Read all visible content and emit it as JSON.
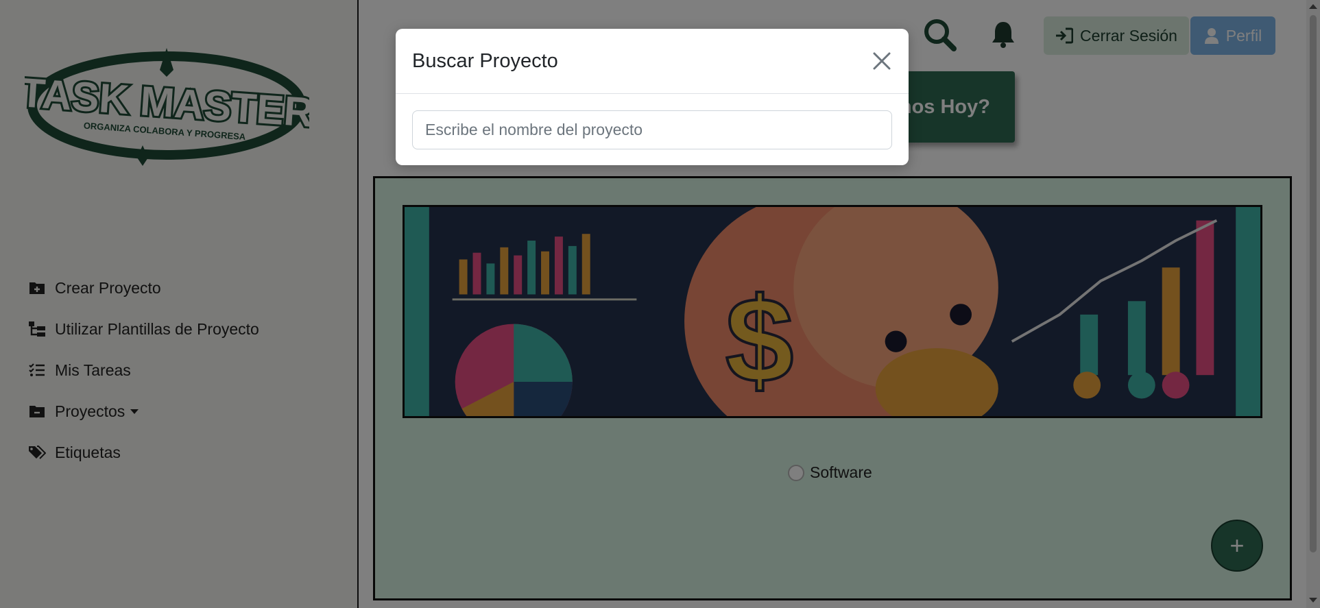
{
  "brand": {
    "logo_title": "TASK MASTER",
    "logo_tagline": "ORGANIZA COLABORA Y PROGRESA",
    "color_dark_green": "#1e4a36"
  },
  "sidebar": {
    "items": [
      {
        "label": "Crear Proyecto",
        "icon": "folder-plus-icon"
      },
      {
        "label": "Utilizar Plantillas de Proyecto",
        "icon": "template-tree-icon"
      },
      {
        "label": "Mis Tareas",
        "icon": "list-check-icon"
      },
      {
        "label": "Proyectos",
        "icon": "folder-minus-icon",
        "has_dropdown": true
      },
      {
        "label": "Etiquetas",
        "icon": "tags-icon"
      }
    ]
  },
  "header": {
    "search_icon": "search-icon",
    "notifications_icon": "bell-icon",
    "logout_label": "Cerrar Sesión",
    "profile_label": "Perfil",
    "greeting_visible_text": "nos Hoy?"
  },
  "project_card": {
    "option_label": "Software",
    "add_button_label": "+"
  },
  "modal": {
    "title": "Buscar Proyecto",
    "input_placeholder": "Escribe el nombre del proyecto",
    "input_value": ""
  },
  "colors": {
    "accent": "#2e6a52",
    "panel_bg": "#d6f2e2",
    "logout_bg": "#d8ebdc",
    "profile_bg": "#7eb4e6"
  }
}
